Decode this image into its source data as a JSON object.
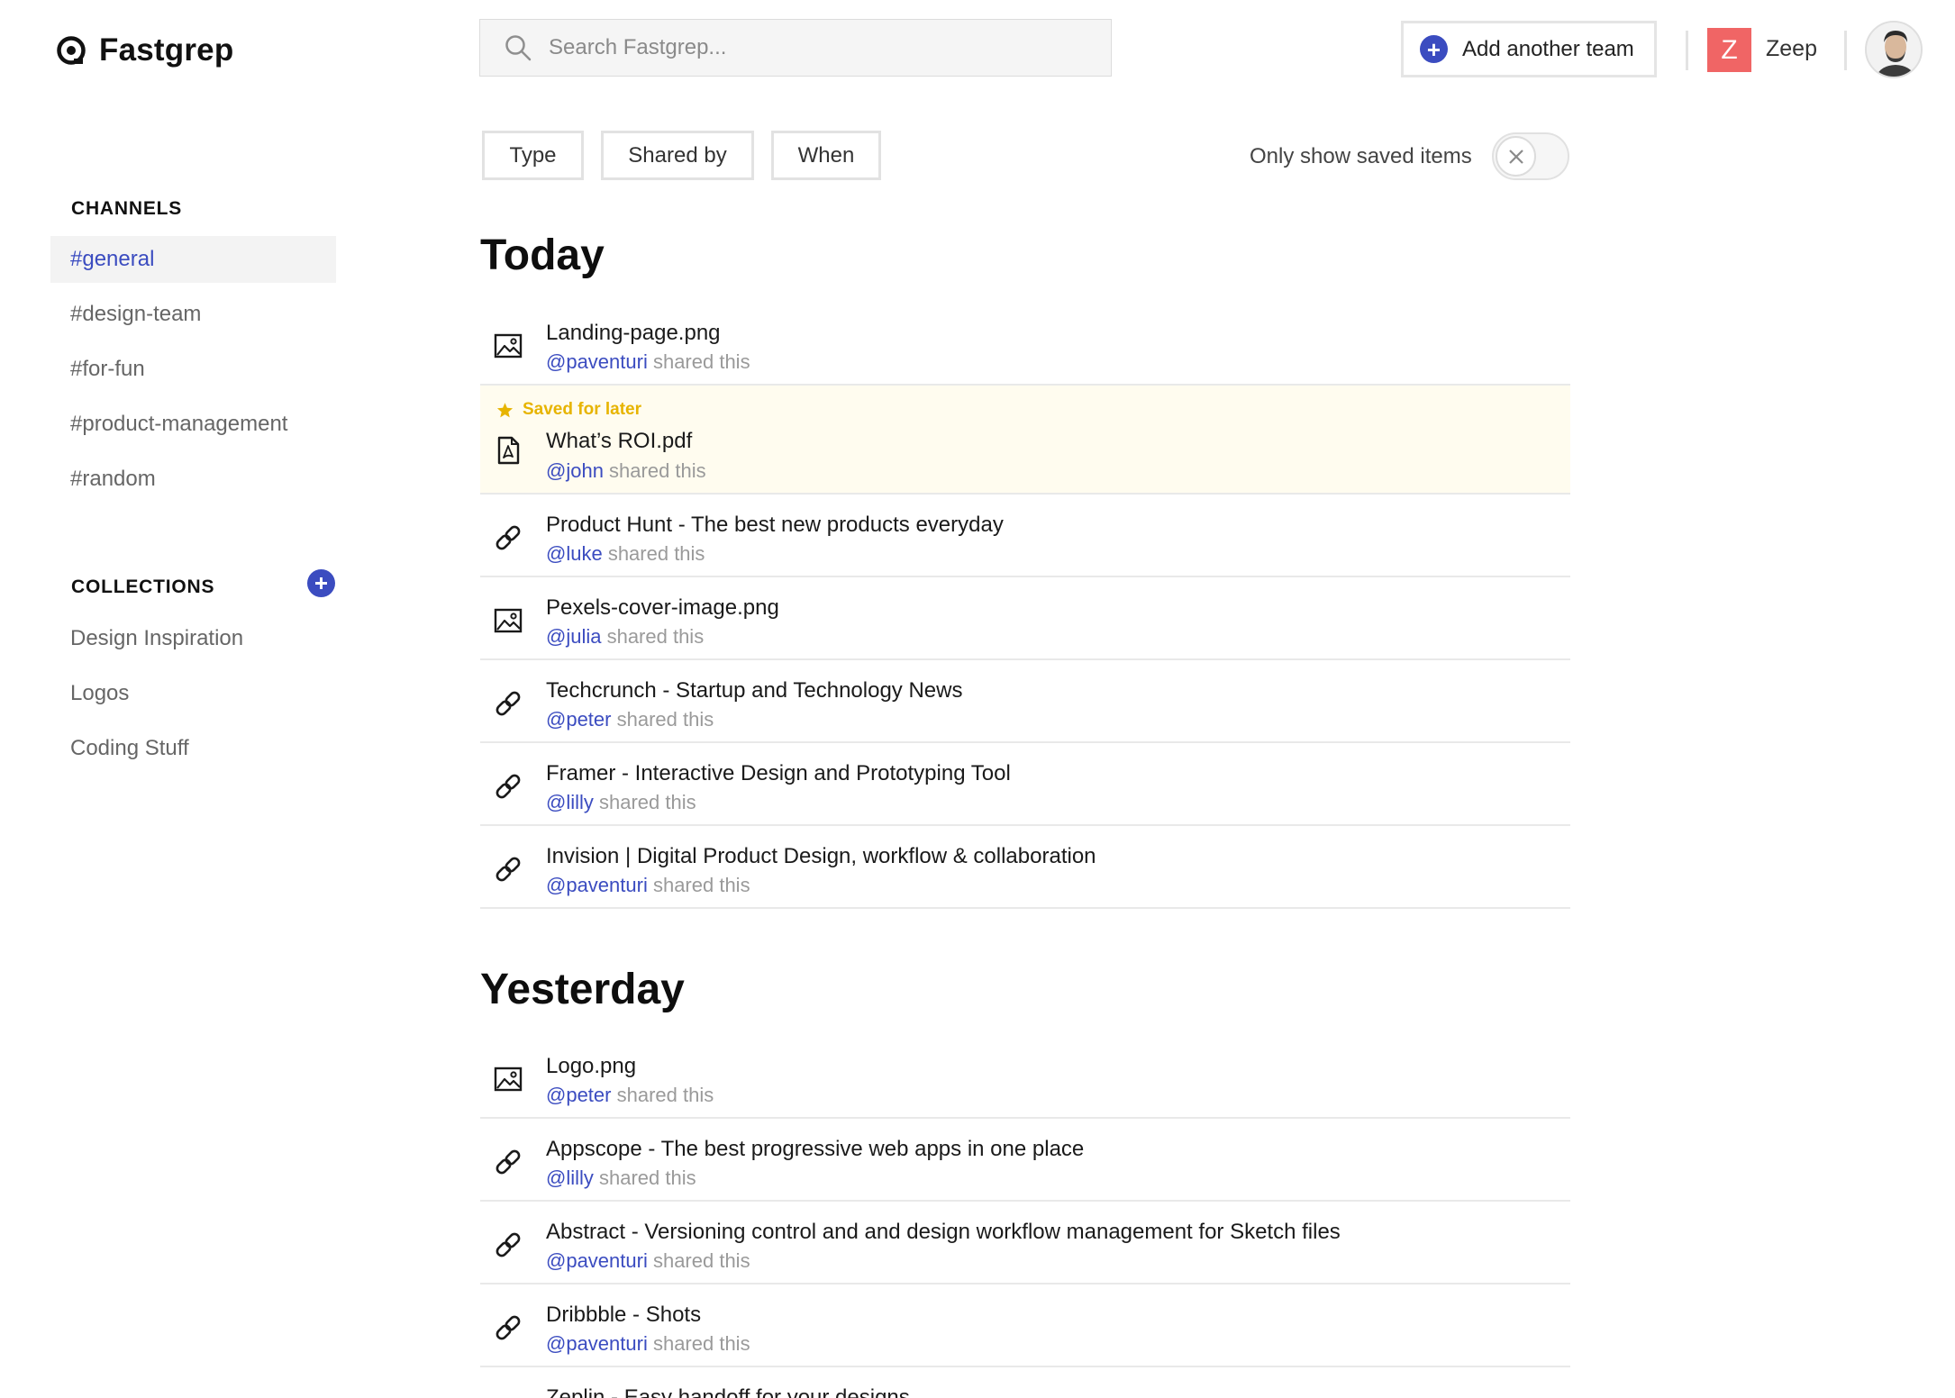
{
  "app": {
    "name": "Fastgrep",
    "colors": {
      "accent": "#3b4cc0",
      "team_avatar": "#f06565",
      "saved_tag": "#e7b400",
      "saved_bg": "#fffcef"
    }
  },
  "search": {
    "placeholder": "Search Fastgrep..."
  },
  "header": {
    "add_team_label": "Add another team",
    "team_initial": "Z",
    "team_name": "Zeep"
  },
  "sidebar": {
    "channels_title": "CHANNELS",
    "channels": [
      {
        "label": "#general",
        "active": true
      },
      {
        "label": "#design-team",
        "active": false
      },
      {
        "label": "#for-fun",
        "active": false
      },
      {
        "label": "#product-management",
        "active": false
      },
      {
        "label": "#random",
        "active": false
      }
    ],
    "collections_title": "COLLECTIONS",
    "collections": [
      {
        "label": "Design Inspiration"
      },
      {
        "label": "Logos"
      },
      {
        "label": "Coding Stuff"
      }
    ]
  },
  "filters": {
    "type": "Type",
    "shared_by": "Shared by",
    "when": "When",
    "saved_toggle_label": "Only show saved items",
    "saved_toggle_on": false
  },
  "groups": {
    "today": {
      "title": "Today",
      "items": [
        {
          "icon": "image-icon",
          "title": "Landing-page.png",
          "user": "@paventuri",
          "suffix": " shared this"
        },
        {
          "icon": "pdf-icon",
          "title": "What’s ROI.pdf",
          "user": "@john",
          "suffix": " shared this",
          "saved_label": "Saved for later"
        },
        {
          "icon": "link-icon",
          "title": "Product Hunt - The best new products everyday",
          "user": "@luke",
          "suffix": " shared this"
        },
        {
          "icon": "image-icon",
          "title": "Pexels-cover-image.png",
          "user": "@julia",
          "suffix": " shared this"
        },
        {
          "icon": "link-icon",
          "title": "Techcrunch - Startup and Technology News",
          "user": "@peter",
          "suffix": " shared this"
        },
        {
          "icon": "link-icon",
          "title": "Framer - Interactive Design and Prototyping Tool",
          "user": "@lilly",
          "suffix": " shared this"
        },
        {
          "icon": "link-icon",
          "title": "Invision | Digital Product Design, workflow & collaboration",
          "user": "@paventuri",
          "suffix": " shared this"
        }
      ]
    },
    "yesterday": {
      "title": "Yesterday",
      "items": [
        {
          "icon": "image-icon",
          "title": "Logo.png",
          "user": "@peter",
          "suffix": " shared this"
        },
        {
          "icon": "link-icon",
          "title": "Appscope - The best progressive web apps in one place",
          "user": "@lilly",
          "suffix": " shared this"
        },
        {
          "icon": "link-icon",
          "title": "Abstract - Versioning control and and design workflow management for Sketch files",
          "user": "@paventuri",
          "suffix": " shared this"
        },
        {
          "icon": "link-icon",
          "title": "Dribbble - Shots",
          "user": "@paventuri",
          "suffix": " shared this"
        },
        {
          "icon": "link-icon",
          "title": "Zeplin - Easy handoff for your designs",
          "user": "",
          "suffix": ""
        }
      ]
    }
  }
}
